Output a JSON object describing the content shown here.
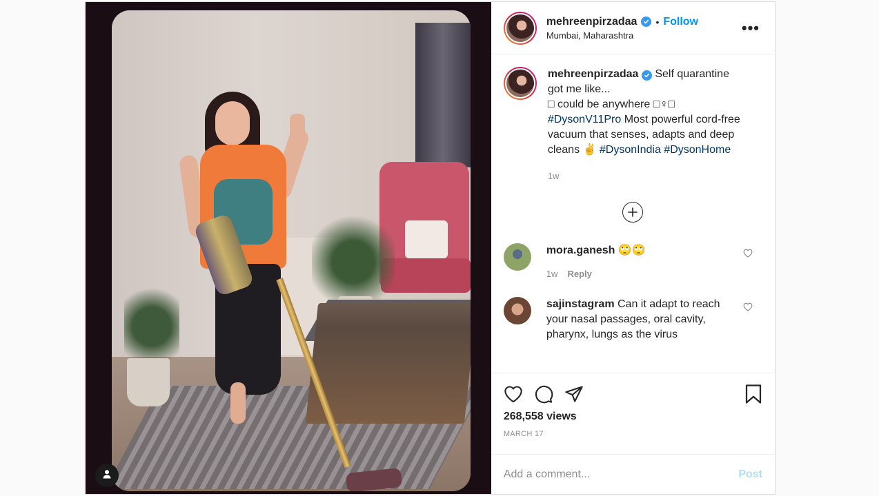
{
  "post": {
    "author": {
      "username": "mehreenpirzadaa",
      "verified": true,
      "location": "Mumbai, Maharashtra",
      "follow_label": "Follow",
      "dot": "•"
    },
    "more_options_label": "•••",
    "caption": {
      "username": "mehreenpirzadaa",
      "line1": " Self quarantine got me like...",
      "line2": "□ could be anywhere □♀□",
      "hashtag1": "#DysonV11Pro",
      "text2": " Most powerful cord-free vacuum that senses, adapts and deep cleans ✌ ",
      "hashtag2": "#DysonIndia",
      "hashtag3": "#DysonHome",
      "age": "1w"
    },
    "comments": [
      {
        "username": "mora.ganesh",
        "text": " 🙄🙄",
        "age": "1w",
        "reply_label": "Reply"
      },
      {
        "username": "sajinstagram",
        "text": " Can it adapt to reach your nasal passages, oral cavity, pharynx, lungs as the virus"
      }
    ],
    "views": "268,558 views",
    "date": "MARCH 17",
    "add_comment": {
      "placeholder": "Add a comment...",
      "post_label": "Post"
    }
  },
  "icons": {
    "verified": "verified-badge-icon",
    "more": "more-options-icon",
    "load_more": "plus-circle-icon",
    "like": "heart-icon",
    "comment": "comment-icon",
    "share": "paper-plane-icon",
    "save": "bookmark-icon",
    "user_tag": "person-icon"
  },
  "colors": {
    "accent_blue": "#0095f6",
    "hashtag": "#00376b",
    "muted": "#8e8e8e",
    "post_disabled": "#b2dffc"
  }
}
